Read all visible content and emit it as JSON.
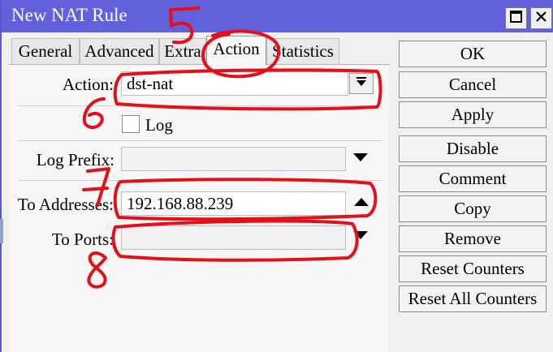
{
  "window": {
    "title": "New NAT Rule",
    "colors": {
      "titlebar": "#6360dc",
      "annotation": "#e3101a"
    }
  },
  "tabs": [
    {
      "label": "General",
      "active": false
    },
    {
      "label": "Advanced",
      "active": false
    },
    {
      "label": "Extra",
      "active": false
    },
    {
      "label": "Action",
      "active": true
    },
    {
      "label": "Statistics",
      "active": false
    }
  ],
  "form": {
    "action": {
      "label": "Action:",
      "value": "dst-nat"
    },
    "log": {
      "label": "Log",
      "checked": false
    },
    "log_prefix": {
      "label": "Log Prefix:",
      "value": ""
    },
    "to_addresses": {
      "label": "To Addresses:",
      "value": "192.168.88.239"
    },
    "to_ports": {
      "label": "To Ports:",
      "value": ""
    }
  },
  "buttons": [
    "OK",
    "Cancel",
    "Apply",
    "Disable",
    "Comment",
    "Copy",
    "Remove",
    "Reset Counters",
    "Reset All Counters"
  ],
  "annotations": [
    "5",
    "6",
    "7",
    "8"
  ]
}
